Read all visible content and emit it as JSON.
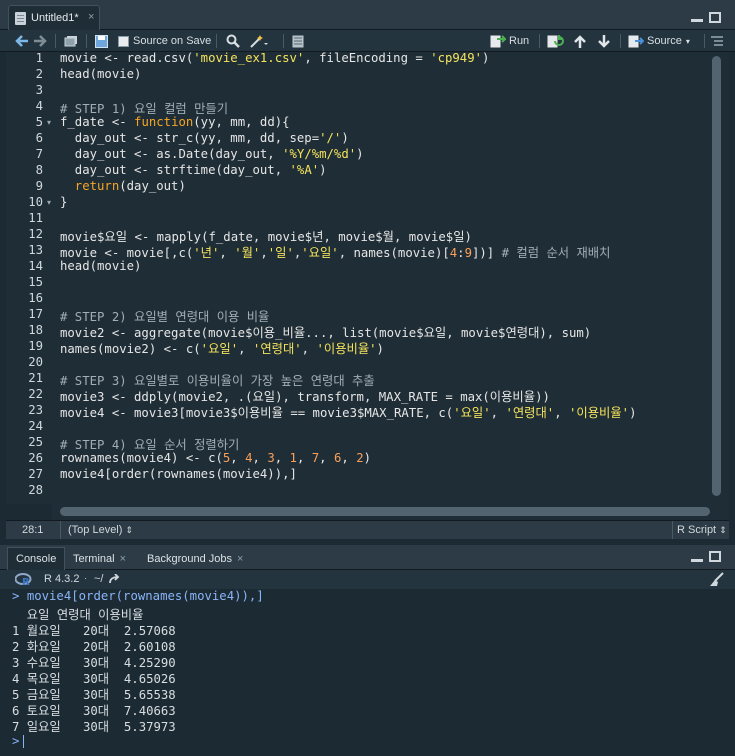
{
  "editor_tab": {
    "title": "Untitled1*",
    "close": "×"
  },
  "toolbar": {
    "source_on_save": "Source on Save",
    "run": "Run",
    "source": "Source"
  },
  "lines": [
    {
      "n": "1",
      "tokens": [
        {
          "t": "movie <- read.csv(",
          "c": ""
        },
        {
          "t": "'movie_ex1.csv'",
          "c": "str"
        },
        {
          "t": ", fileEncoding = ",
          "c": ""
        },
        {
          "t": "'cp949'",
          "c": "str"
        },
        {
          "t": ")",
          "c": ""
        }
      ]
    },
    {
      "n": "2",
      "tokens": [
        {
          "t": "head(movie)",
          "c": ""
        }
      ]
    },
    {
      "n": "3",
      "tokens": []
    },
    {
      "n": "4",
      "tokens": [
        {
          "t": "# STEP 1) 요일 컬럼 만들기",
          "c": "cm"
        }
      ]
    },
    {
      "n": "5",
      "fold": true,
      "tokens": [
        {
          "t": "f_date <- ",
          "c": ""
        },
        {
          "t": "function",
          "c": "kw"
        },
        {
          "t": "(yy, mm, dd){",
          "c": ""
        }
      ]
    },
    {
      "n": "6",
      "tokens": [
        {
          "t": "  day_out <- str_c(yy, mm, dd, sep=",
          "c": ""
        },
        {
          "t": "'/'",
          "c": "str"
        },
        {
          "t": ")",
          "c": ""
        }
      ]
    },
    {
      "n": "7",
      "tokens": [
        {
          "t": "  day_out <- as.Date(day_out, ",
          "c": ""
        },
        {
          "t": "'%Y/%m/%d'",
          "c": "str"
        },
        {
          "t": ")",
          "c": ""
        }
      ]
    },
    {
      "n": "8",
      "tokens": [
        {
          "t": "  day_out <- strftime(day_out, ",
          "c": ""
        },
        {
          "t": "'%A'",
          "c": "str"
        },
        {
          "t": ")",
          "c": ""
        }
      ]
    },
    {
      "n": "9",
      "tokens": [
        {
          "t": "  return",
          "c": "kw"
        },
        {
          "t": "(day_out)",
          "c": ""
        }
      ]
    },
    {
      "n": "10",
      "fold": true,
      "tokens": [
        {
          "t": "}",
          "c": ""
        }
      ]
    },
    {
      "n": "11",
      "tokens": []
    },
    {
      "n": "12",
      "tokens": [
        {
          "t": "movie$요일 <- mapply(f_date, movie$년, movie$월, movie$일)",
          "c": ""
        }
      ]
    },
    {
      "n": "13",
      "tokens": [
        {
          "t": "movie <- movie[,c(",
          "c": ""
        },
        {
          "t": "'년'",
          "c": "str"
        },
        {
          "t": ", ",
          "c": ""
        },
        {
          "t": "'월'",
          "c": "str"
        },
        {
          "t": ",",
          "c": ""
        },
        {
          "t": "'일'",
          "c": "str"
        },
        {
          "t": ",",
          "c": ""
        },
        {
          "t": "'요일'",
          "c": "str"
        },
        {
          "t": ", names(movie)[",
          "c": ""
        },
        {
          "t": "4",
          "c": "num"
        },
        {
          "t": ":",
          "c": ""
        },
        {
          "t": "9",
          "c": "num"
        },
        {
          "t": "])] ",
          "c": ""
        },
        {
          "t": "# 컬럼 순서 재배치",
          "c": "cm"
        }
      ]
    },
    {
      "n": "14",
      "tokens": [
        {
          "t": "head(movie)",
          "c": ""
        }
      ]
    },
    {
      "n": "15",
      "tokens": []
    },
    {
      "n": "16",
      "tokens": []
    },
    {
      "n": "17",
      "tokens": [
        {
          "t": "# STEP 2) 요일별 연령대 이용 비율",
          "c": "cm"
        }
      ]
    },
    {
      "n": "18",
      "tokens": [
        {
          "t": "movie2 <- aggregate(movie$이용_비율..., list(movie$요일, movie$연령대), sum)",
          "c": ""
        }
      ]
    },
    {
      "n": "19",
      "tokens": [
        {
          "t": "names(movie2) <- c(",
          "c": ""
        },
        {
          "t": "'요일'",
          "c": "str"
        },
        {
          "t": ", ",
          "c": ""
        },
        {
          "t": "'연령대'",
          "c": "str"
        },
        {
          "t": ", ",
          "c": ""
        },
        {
          "t": "'이용비율'",
          "c": "str"
        },
        {
          "t": ")",
          "c": ""
        }
      ]
    },
    {
      "n": "20",
      "tokens": []
    },
    {
      "n": "21",
      "tokens": [
        {
          "t": "# STEP 3) 요일별로 이용비율이 가장 높은 연령대 추출",
          "c": "cm"
        }
      ]
    },
    {
      "n": "22",
      "tokens": [
        {
          "t": "movie3 <- ddply(movie2, .(요일), transform, MAX_RATE = max(이용비율))",
          "c": ""
        }
      ]
    },
    {
      "n": "23",
      "tokens": [
        {
          "t": "movie4 <- movie3[movie3$이용비율 == movie3$MAX_RATE, c(",
          "c": ""
        },
        {
          "t": "'요일'",
          "c": "str"
        },
        {
          "t": ", ",
          "c": ""
        },
        {
          "t": "'연령대'",
          "c": "str"
        },
        {
          "t": ", ",
          "c": ""
        },
        {
          "t": "'이용비율'",
          "c": "str"
        },
        {
          "t": ")",
          "c": ""
        }
      ]
    },
    {
      "n": "24",
      "tokens": []
    },
    {
      "n": "25",
      "tokens": [
        {
          "t": "# STEP 4) 요일 순서 정렬하기",
          "c": "cm"
        }
      ]
    },
    {
      "n": "26",
      "tokens": [
        {
          "t": "rownames(movie4) <- c(",
          "c": ""
        },
        {
          "t": "5",
          "c": "num"
        },
        {
          "t": ", ",
          "c": ""
        },
        {
          "t": "4",
          "c": "num"
        },
        {
          "t": ", ",
          "c": ""
        },
        {
          "t": "3",
          "c": "num"
        },
        {
          "t": ", ",
          "c": ""
        },
        {
          "t": "1",
          "c": "num"
        },
        {
          "t": ", ",
          "c": ""
        },
        {
          "t": "7",
          "c": "num"
        },
        {
          "t": ", ",
          "c": ""
        },
        {
          "t": "6",
          "c": "num"
        },
        {
          "t": ", ",
          "c": ""
        },
        {
          "t": "2",
          "c": "num"
        },
        {
          "t": ")",
          "c": ""
        }
      ]
    },
    {
      "n": "27",
      "tokens": [
        {
          "t": "movie4[order(rownames(movie4)),]",
          "c": ""
        }
      ]
    },
    {
      "n": "28",
      "tokens": []
    }
  ],
  "status": {
    "position": "28:1",
    "scope": "(Top Level)",
    "filetype": "R Script"
  },
  "console_tabs": [
    "Console",
    "Terminal",
    "Background Jobs"
  ],
  "console_info": {
    "r_version": "R 4.3.2",
    "path": "~/"
  },
  "console": {
    "prompt": ">",
    "command": "movie4[order(rownames(movie4)),]",
    "header": "  요일 연령대 이용비율",
    "rows": [
      "1 월요일   20대  2.57068",
      "2 화요일   20대  2.60108",
      "3 수요일   30대  4.25290",
      "4 목요일   30대  4.65026",
      "5 금요일   30대  5.65538",
      "6 토요일   30대  7.40663",
      "7 일요일   30대  5.37973"
    ]
  }
}
